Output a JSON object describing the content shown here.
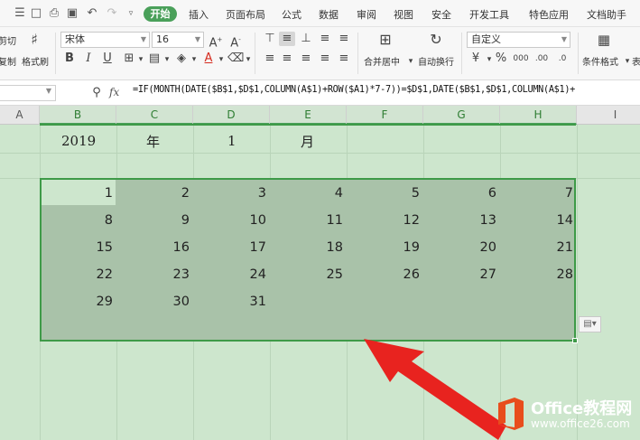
{
  "menubar": {
    "active_tab": "开始",
    "tabs": [
      "插入",
      "页面布局",
      "公式",
      "数据",
      "审阅",
      "视图",
      "安全",
      "开发工具",
      "特色应用",
      "文档助手"
    ]
  },
  "ribbon": {
    "cut_label": "剪切",
    "copy_label": "复制",
    "format_painter_label": "格式刷",
    "font_name": "宋体",
    "font_size": "16",
    "merge_center_label": "合并居中",
    "wrap_text_label": "自动换行",
    "number_format": "自定义",
    "conditional_format_label": "条件格式",
    "table_style_label": "表"
  },
  "formula_bar": {
    "fx": "fx",
    "formula": "=IF(MONTH(DATE($B$1,$D$1,COLUMN(A$1)+ROW($A1)*7-7))=$D$1,DATE($B$1,$D$1,COLUMN(A$1)+"
  },
  "columns": [
    "A",
    "B",
    "C",
    "D",
    "E",
    "F",
    "G",
    "H",
    "I"
  ],
  "row1": {
    "year": "2019",
    "year_unit": "年",
    "month": "1",
    "month_unit": "月"
  },
  "calendar": [
    [
      "1",
      "2",
      "3",
      "4",
      "5",
      "6",
      "7"
    ],
    [
      "8",
      "9",
      "10",
      "11",
      "12",
      "13",
      "14"
    ],
    [
      "15",
      "16",
      "17",
      "18",
      "19",
      "20",
      "21"
    ],
    [
      "22",
      "23",
      "24",
      "25",
      "26",
      "27",
      "28"
    ],
    [
      "29",
      "30",
      "31",
      "",
      "",
      "",
      ""
    ],
    [
      "",
      "",
      "",
      "",
      "",
      "",
      ""
    ]
  ],
  "watermark": {
    "title": "Office教程网",
    "url": "www.office26.com"
  },
  "colors": {
    "accent": "#4aa05a",
    "sheet_bg": "#cde6cd",
    "selection": "#a9c2a9",
    "arrow": "#e8231f"
  }
}
